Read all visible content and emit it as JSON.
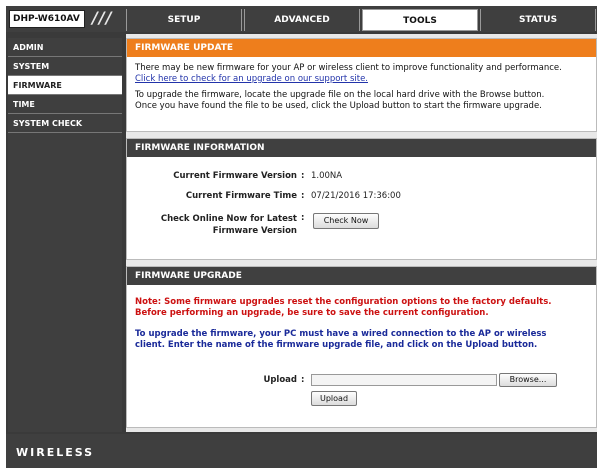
{
  "header": {
    "model": "DHP-W610AV",
    "slashes": "///",
    "tabs": [
      {
        "label": "SETUP"
      },
      {
        "label": "ADVANCED"
      },
      {
        "label": "TOOLS"
      },
      {
        "label": "STATUS"
      }
    ],
    "active_tab": "TOOLS"
  },
  "sidebar": {
    "items": [
      {
        "label": "ADMIN"
      },
      {
        "label": "SYSTEM"
      },
      {
        "label": "FIRMWARE"
      },
      {
        "label": "TIME"
      },
      {
        "label": "SYSTEM CHECK"
      }
    ],
    "active": "FIRMWARE"
  },
  "firmware_update": {
    "title": "FIRMWARE UPDATE",
    "line1": "There may be new firmware for your AP or wireless client to improve functionality and performance.",
    "link": "Click here to check for an upgrade on our support site.",
    "line2": "To upgrade the firmware, locate the upgrade file on the local hard drive with the Browse button.",
    "line3": "Once you have found the file to be used, click the Upload button to start the firmware upgrade."
  },
  "firmware_info": {
    "title": "FIRMWARE INFORMATION",
    "version_label": "Current Firmware Version",
    "version_value": "1.00NA",
    "time_label": "Current Firmware Time",
    "time_value": "07/21/2016 17:36:00",
    "check_label_1": "Check Online Now for Latest",
    "check_label_2": "Firmware Version",
    "check_button": "Check Now",
    "colon": ":"
  },
  "firmware_upgrade": {
    "title": "FIRMWARE UPGRADE",
    "note_1": "Note: Some firmware upgrades reset the configuration options to the factory defaults.",
    "note_2": "Before performing an upgrade, be sure to save the current configuration.",
    "info_1": "To upgrade the firmware, your PC must have a wired connection to the AP or wireless",
    "info_2": "client. Enter the name of the firmware upgrade file, and click on the Upload button.",
    "upload_label": "Upload",
    "colon": ":",
    "file_value": "",
    "browse_button": "Browse...",
    "upload_button": "Upload"
  },
  "footer": {
    "brand": "WIRELESS"
  },
  "colors": {
    "orange": "#ee7e1c",
    "dark": "#404040",
    "red_note": "#cc1111",
    "blue_note": "#1a2a99"
  }
}
